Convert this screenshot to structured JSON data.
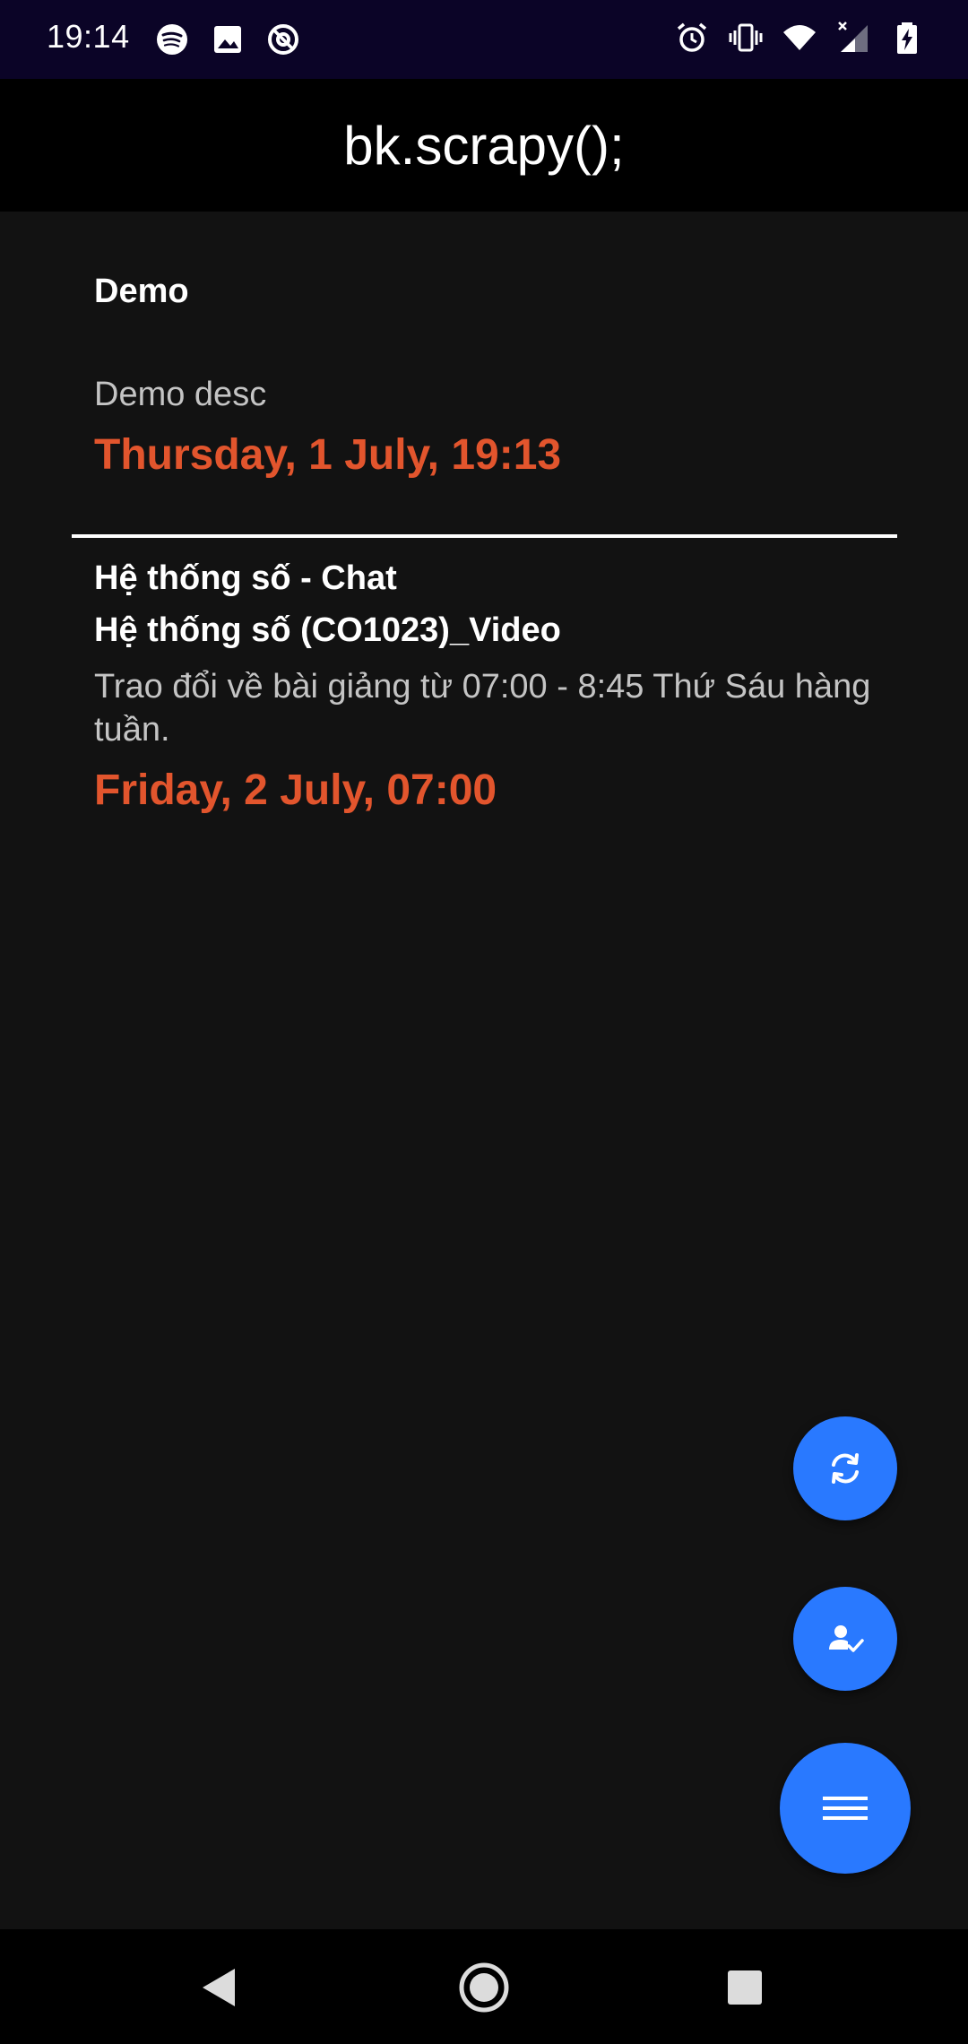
{
  "status_bar": {
    "time": "19:14",
    "left_icons": [
      "spotify-icon",
      "image-icon",
      "at-sign-icon"
    ],
    "right_icons": [
      "alarm-icon",
      "vibrate-icon",
      "wifi-icon",
      "signal-icon",
      "battery-charging-icon"
    ]
  },
  "app_bar": {
    "title": "bk.scrapy();"
  },
  "items": [
    {
      "title": "Demo",
      "subtitle": "",
      "description": "Demo desc",
      "date": "Thursday, 1 July, 19:13"
    },
    {
      "title": "Hệ thống số - Chat",
      "subtitle": "Hệ thống số (CO1023)_Video",
      "description": "Trao đổi về bài giảng từ 07:00 - 8:45 Thứ Sáu hàng tuần.",
      "date": "Friday, 2 July, 07:00"
    }
  ],
  "fabs": {
    "refresh_icon": "refresh-icon",
    "account_icon": "account-check-icon",
    "menu_icon": "menu-icon"
  },
  "colors": {
    "accent": "#2979ff",
    "date": "#e2552d",
    "background": "#121212",
    "status_bar": "#0b0427"
  },
  "nav_bar": {
    "icons": [
      "back-icon",
      "home-icon",
      "recents-icon"
    ]
  }
}
